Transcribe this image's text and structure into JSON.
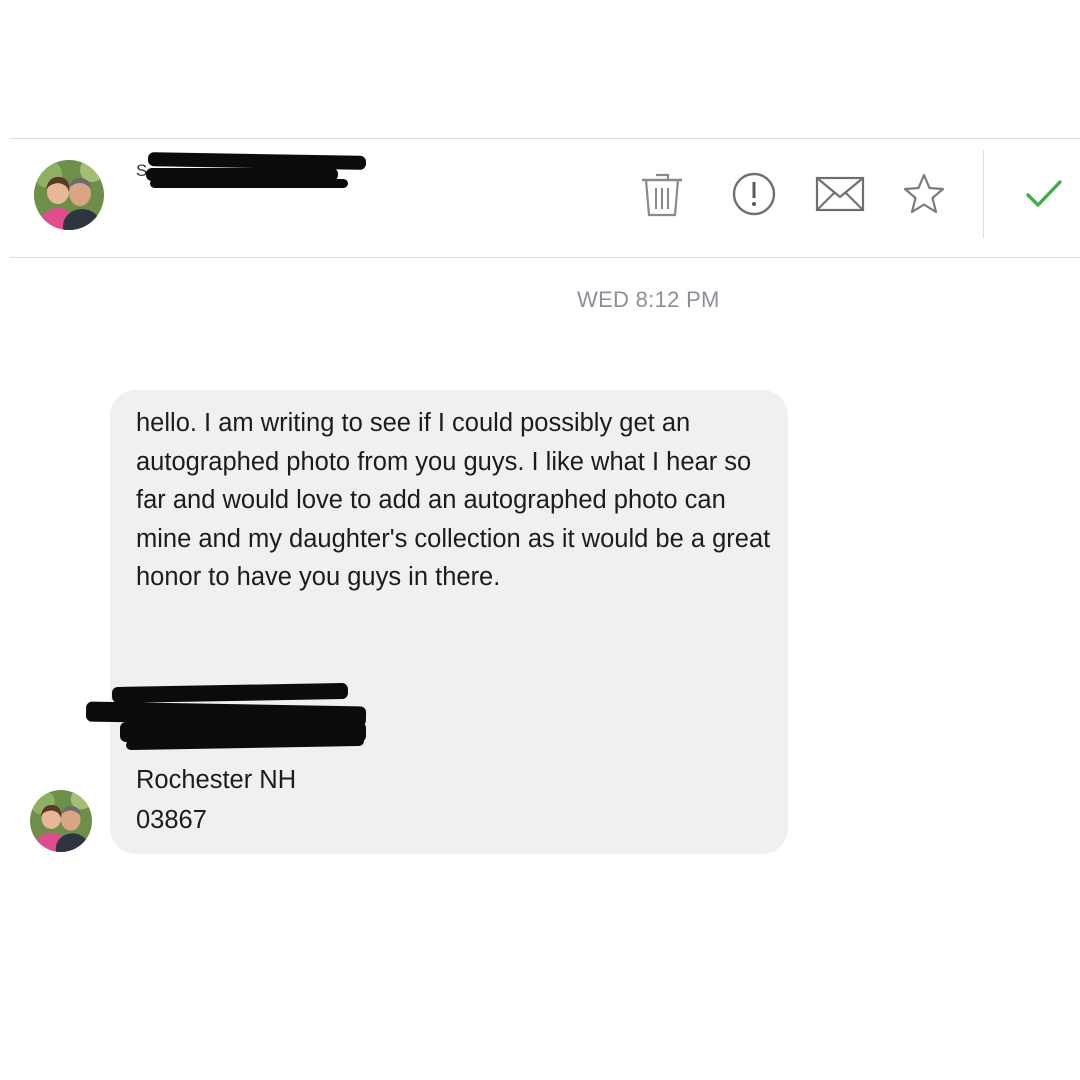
{
  "header": {
    "sender_initial": "S",
    "actions": {
      "delete": "trash-icon",
      "report": "exclamation-icon",
      "mark_unread": "envelope-icon",
      "star": "star-icon",
      "done": "check-icon"
    },
    "colors": {
      "check": "#3fae49",
      "icons": "#8a8a8a"
    }
  },
  "conversation": {
    "timestamp": "WED 8:12 PM",
    "message": {
      "body": "hello. I am writing to see if I could possibly get an autographed photo from you guys. I like what I hear so far and would love to add an autographed photo can mine and my daughter's collection as it would be a great honor to have you guys in there.",
      "address_city": "Rochester NH",
      "address_zip": "03867"
    }
  }
}
